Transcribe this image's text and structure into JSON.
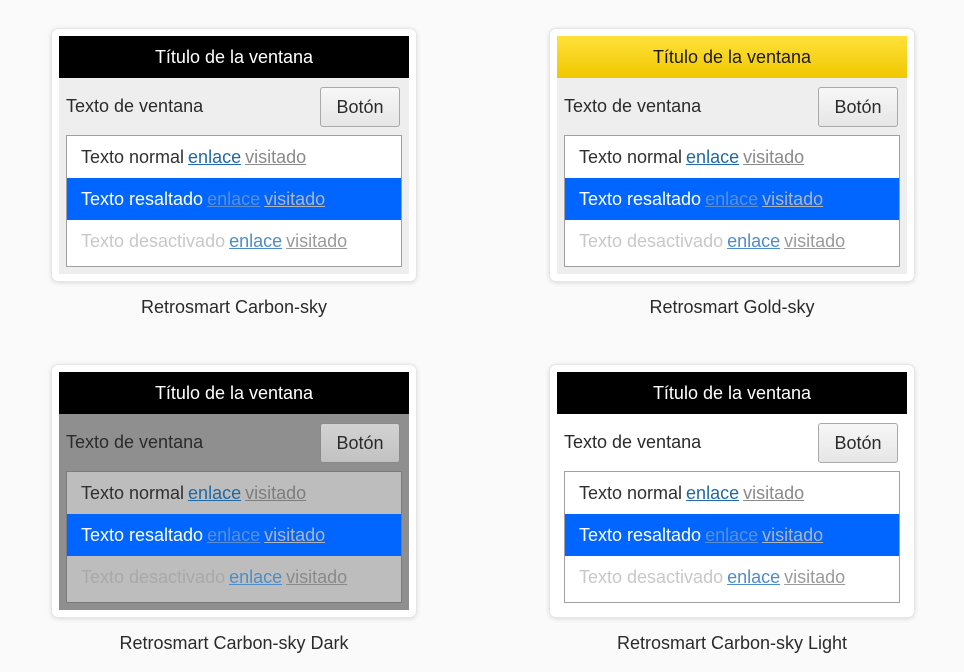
{
  "previews": [
    {
      "window_title": "Título de la ventana",
      "window_text": "Texto de ventana",
      "button_label": "Botón",
      "rows": [
        {
          "text": "Texto normal",
          "link": "enlace",
          "visited": "visitado"
        },
        {
          "text": "Texto resaltado",
          "link": "enlace",
          "visited": "visitado"
        },
        {
          "text": "Texto desactivado",
          "link": "enlace",
          "visited": "visitado"
        }
      ],
      "caption": "Retrosmart Carbon-sky"
    },
    {
      "window_title": "Título de la ventana",
      "window_text": "Texto de ventana",
      "button_label": "Botón",
      "rows": [
        {
          "text": "Texto normal",
          "link": "enlace",
          "visited": "visitado"
        },
        {
          "text": "Texto resaltado",
          "link": "enlace",
          "visited": "visitado"
        },
        {
          "text": "Texto desactivado",
          "link": "enlace",
          "visited": "visitado"
        }
      ],
      "caption": "Retrosmart Gold-sky"
    },
    {
      "window_title": "Título de la ventana",
      "window_text": "Texto de ventana",
      "button_label": "Botón",
      "rows": [
        {
          "text": "Texto normal",
          "link": "enlace",
          "visited": "visitado"
        },
        {
          "text": "Texto resaltado",
          "link": "enlace",
          "visited": "visitado"
        },
        {
          "text": "Texto desactivado",
          "link": "enlace",
          "visited": "visitado"
        }
      ],
      "caption": "Retrosmart Carbon-sky Dark"
    },
    {
      "window_title": "Título de la ventana",
      "window_text": "Texto de ventana",
      "button_label": "Botón",
      "rows": [
        {
          "text": "Texto normal",
          "link": "enlace",
          "visited": "visitado"
        },
        {
          "text": "Texto resaltado",
          "link": "enlace",
          "visited": "visitado"
        },
        {
          "text": "Texto desactivado",
          "link": "enlace",
          "visited": "visitado"
        }
      ],
      "caption": "Retrosmart Carbon-sky Light"
    }
  ],
  "colors": {
    "title_bar_dark": "#000000",
    "title_bar_gold": "#f5d000",
    "highlight": "#0066ff",
    "link": "#1f6aa5",
    "visited": "#8a8a8a"
  }
}
